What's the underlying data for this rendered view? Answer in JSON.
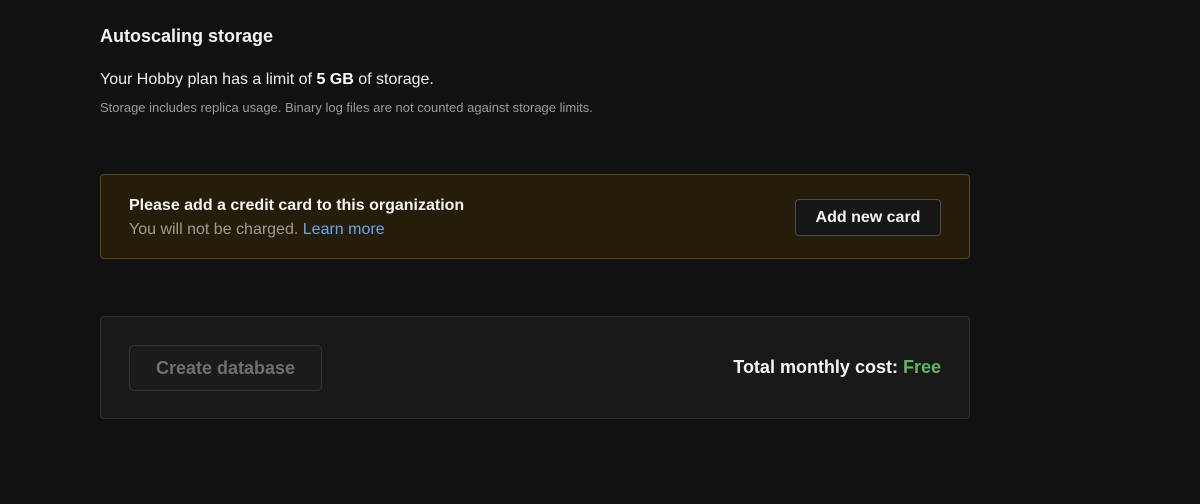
{
  "storage": {
    "title": "Autoscaling storage",
    "limit_prefix": "Your Hobby plan has a limit of",
    "limit_value": "5 GB",
    "limit_suffix": "of storage.",
    "note": "Storage includes replica usage. Binary log files are not counted against storage limits."
  },
  "banner": {
    "title": "Please add a credit card to this organization",
    "subtitle": "You will not be charged.",
    "link": "Learn more",
    "button": "Add new card"
  },
  "footer": {
    "create_button": "Create database",
    "cost_label": "Total monthly cost:",
    "cost_value": "Free"
  },
  "colors": {
    "background": "#111111",
    "banner_background": "#251c0a",
    "link": "#63a8e8",
    "free": "#5cb85c"
  }
}
